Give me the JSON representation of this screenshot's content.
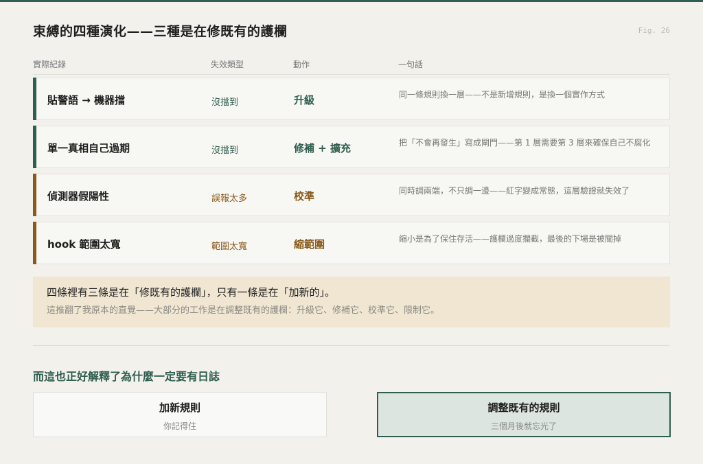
{
  "header": {
    "title": "束縛的四種演化——三種是在修既有的護欄",
    "fig_label": "Fig. 26"
  },
  "table": {
    "columns": [
      "實際紀錄",
      "失效類型",
      "動作",
      "一句話"
    ],
    "rows": [
      {
        "record": "貼警語 → 機器擋",
        "failure": "沒擋到",
        "action": "升級",
        "note": "同一條規則換一層——不是新增規則，是換一個實作方式",
        "accent": "#2f5d4f"
      },
      {
        "record": "單一真相自己過期",
        "failure": "沒擋到",
        "action": "修補 + 擴充",
        "note": "把「不會再發生」寫成閘門——第 1 層需要第 3 層來確保自己不腐化",
        "accent": "#2f5d4f"
      },
      {
        "record": "偵測器假陽性",
        "failure": "誤報太多",
        "action": "校準",
        "note": "同時調兩端，不只調一邊——紅字變成常態，這層驗證就失效了",
        "accent": "#8a5a1c"
      },
      {
        "record": "hook 範圍太寬",
        "failure": "範圍太寬",
        "action": "縮範圍",
        "note": "縮小是為了保住存活——護欄過度攔截，最後的下場是被關掉",
        "accent": "#8a5a1c"
      }
    ]
  },
  "callout": {
    "main": "四條裡有三條是在「修既有的護欄」，只有一條是在「加新的」。",
    "sub": "這推翻了我原本的直覺——大部分的工作是在調整既有的護欄：升級它、修補它、校準它、限制它。"
  },
  "conclusion": {
    "heading": "而這也正好解釋了為什麼一定要有日誌",
    "left": {
      "title": "加新規則",
      "subtitle": "你記得住"
    },
    "right": {
      "title": "調整既有的規則",
      "subtitle": "三個月後就忘光了"
    }
  },
  "colors": {
    "accent_green": "#2f5d4f",
    "accent_brown": "#8a5a1c",
    "callout_bg": "#f0e6d2",
    "highlight_box_bg": "#dde5e0"
  }
}
